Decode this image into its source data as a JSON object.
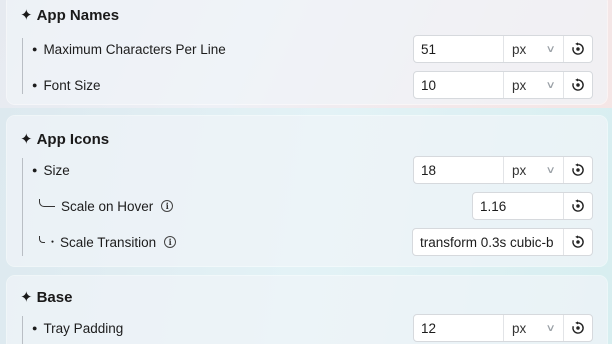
{
  "sections": [
    {
      "title": "App Names",
      "rows": [
        {
          "label": "Maximum Characters Per Line",
          "value": "51",
          "unit": "px"
        },
        {
          "label": "Font Size",
          "value": "10",
          "unit": "px"
        }
      ]
    },
    {
      "title": "App Icons",
      "rows": [
        {
          "label": "Size",
          "value": "18",
          "unit": "px"
        },
        {
          "label": "Scale on Hover",
          "value": "1.16"
        },
        {
          "label": "Scale Transition",
          "value": "transform 0.3s cubic-b"
        }
      ]
    },
    {
      "title": "Base",
      "rows": [
        {
          "label": "Tray Padding",
          "value": "12",
          "unit": "px"
        }
      ]
    }
  ],
  "icons": {
    "section": "sparkle-icon",
    "reset": "reset-icon",
    "info": "info-icon",
    "dropdown": "chevron-down-icon"
  }
}
